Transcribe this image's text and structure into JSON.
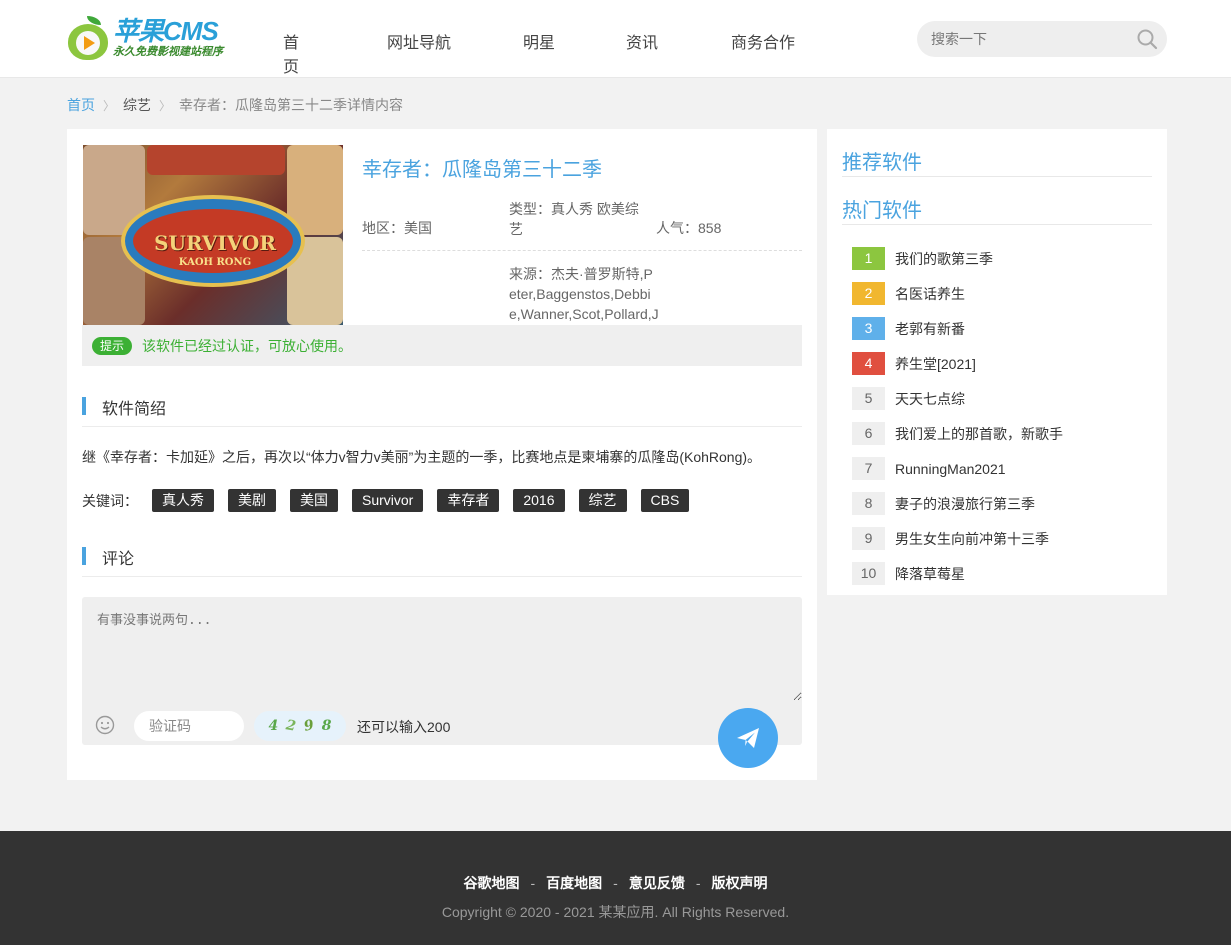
{
  "header": {
    "logo_title": "苹果CMS",
    "logo_sub": "永久免费影视建站程序",
    "nav": [
      "首页",
      "网址导航",
      "明星",
      "资讯",
      "商务合作"
    ],
    "search_placeholder": "搜索一下"
  },
  "breadcrumb": {
    "home": "首页",
    "category": "综艺",
    "current": "幸存者：瓜隆岛第三十二季详情内容"
  },
  "detail": {
    "poster_title": "SURVIVOR",
    "poster_sub": "KAOH RONG",
    "title": "幸存者：瓜隆岛第三十二季",
    "region": "地区：美国",
    "type": "类型：真人秀 欧美综艺",
    "popularity": "人气：858",
    "source": "来源：杰夫·普罗斯特,Peter,Baggenstos,Debbie,Wanner,Scot,Pollard,Julia,Sokolowski,Jason"
  },
  "notice": {
    "tag": "提示",
    "text": "该软件已经过认证，可放心使用。"
  },
  "intro": {
    "heading": "软件简绍",
    "text": "继《幸存者：卡加延》之后，再次以“体力v智力v美丽”为主题的一季，比赛地点是柬埔寨的瓜隆岛(KohRong)。",
    "keywords_label": "关键词：",
    "keywords": [
      "真人秀",
      "美剧",
      "美国",
      "Survivor",
      "幸存者",
      "2016",
      "综艺",
      "CBS"
    ]
  },
  "comment": {
    "heading": "评论",
    "placeholder": "有事没事说两句...",
    "captcha_placeholder": "验证码",
    "captcha_digits": [
      "4",
      "2",
      "9",
      "8"
    ],
    "remain": "还可以输入200"
  },
  "sidebar": {
    "recommend_heading": "推荐软件",
    "hot_heading": "热门软件",
    "hot": [
      {
        "rank": "1",
        "name": "我们的歌第三季"
      },
      {
        "rank": "2",
        "name": "名医话养生"
      },
      {
        "rank": "3",
        "name": "老郭有新番"
      },
      {
        "rank": "4",
        "name": "养生堂[2021]"
      },
      {
        "rank": "5",
        "name": "天天七点综"
      },
      {
        "rank": "6",
        "name": "我们爱上的那首歌，新歌手"
      },
      {
        "rank": "7",
        "name": "RunningMan2021"
      },
      {
        "rank": "8",
        "name": "妻子的浪漫旅行第三季"
      },
      {
        "rank": "9",
        "name": "男生女生向前冲第十三季"
      },
      {
        "rank": "10",
        "name": "降落草莓星"
      }
    ]
  },
  "footer": {
    "links": [
      "谷歌地图",
      "百度地图",
      "意见反馈",
      "版权声明"
    ],
    "separator": "-",
    "copyright": "Copyright © 2020 - 2021 某某应用. All Rights Reserved."
  },
  "colors": {
    "accent": "#4aa3df",
    "success": "#3cb034",
    "footer_bg": "#333333"
  }
}
